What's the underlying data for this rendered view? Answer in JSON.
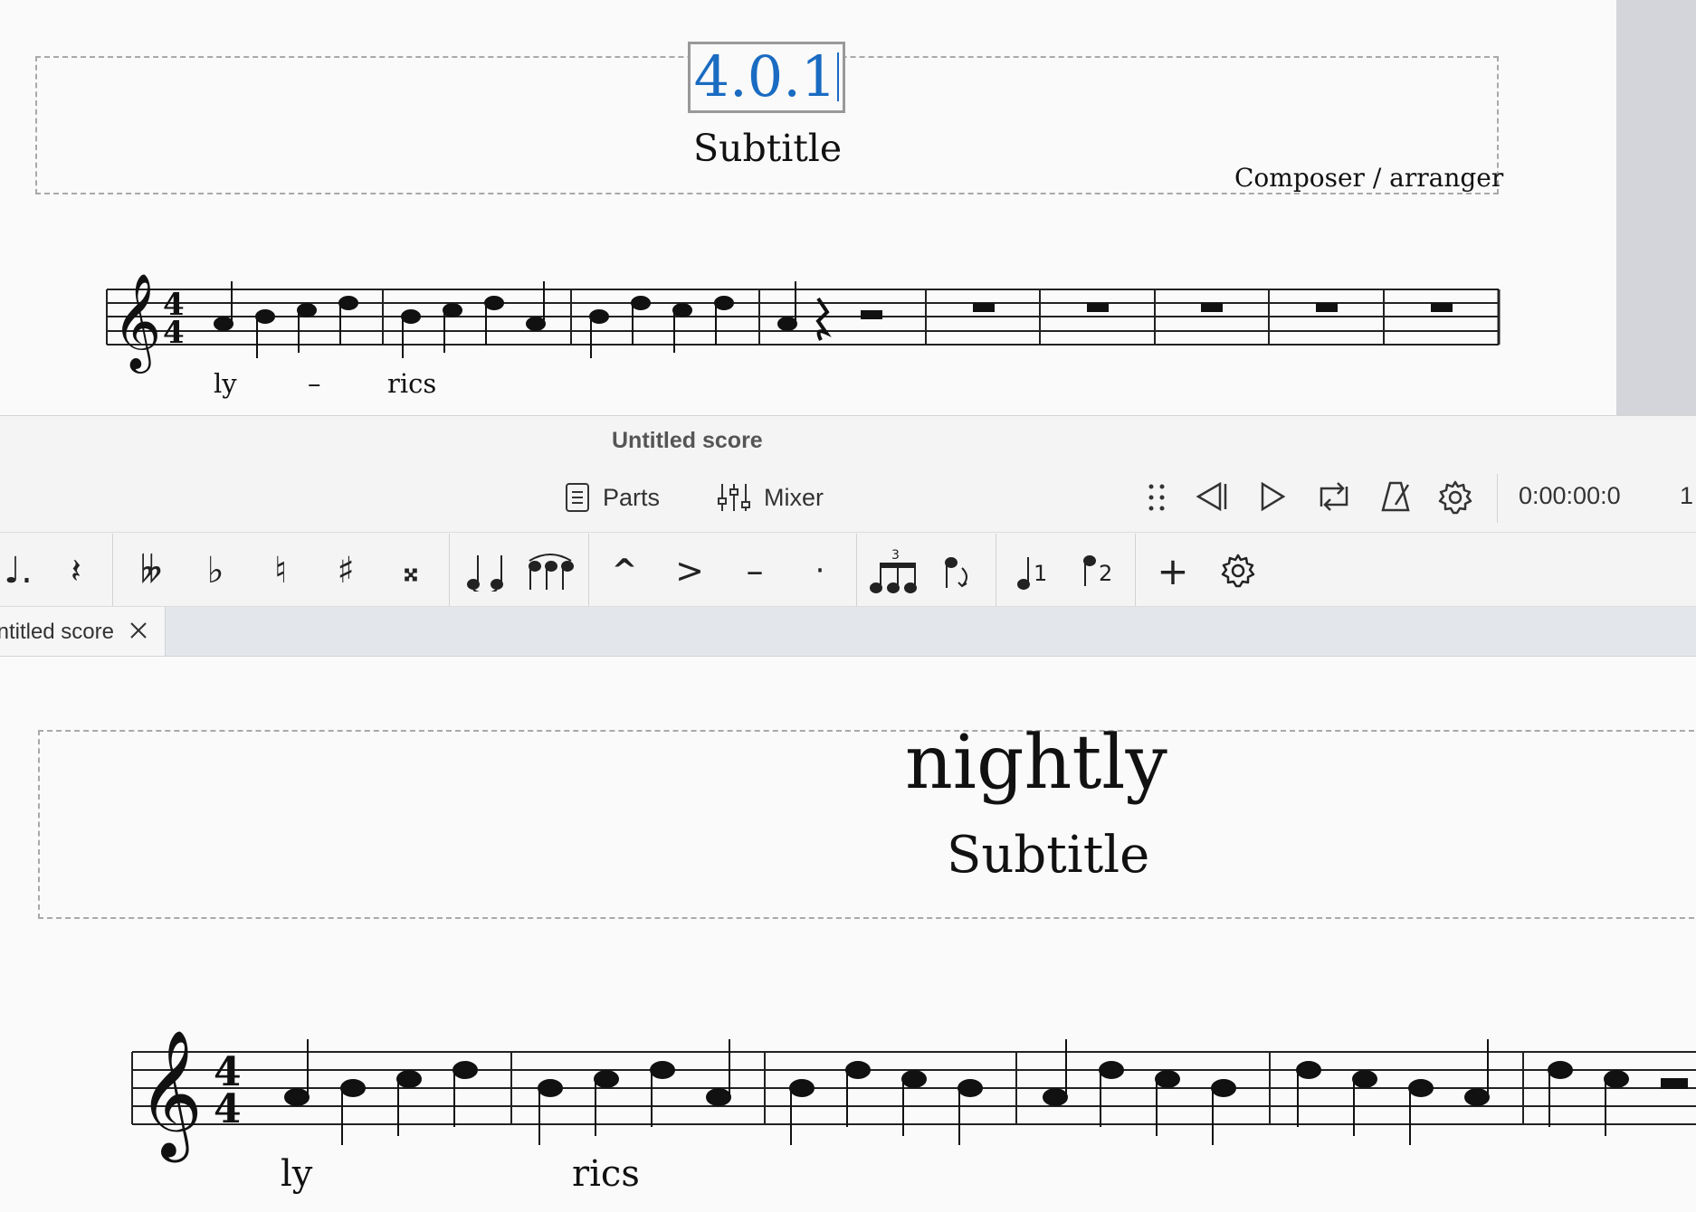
{
  "top_score": {
    "title": "4.0.1",
    "subtitle": "Subtitle",
    "composer": "Composer / arranger",
    "lyrics": [
      "ly",
      "–",
      "rics"
    ]
  },
  "window_title": "Untitled score",
  "toolbar": {
    "parts_label": "Parts",
    "mixer_label": "Mixer",
    "time_display": "0:00:00:0",
    "measure_display": "1"
  },
  "note_input": {
    "tuplet_number": "3",
    "voice_1": "1",
    "voice_2": "2"
  },
  "tab": {
    "label": "Untitled score"
  },
  "bottom_score": {
    "title": "nightly",
    "subtitle": "Subtitle",
    "lyrics": [
      "ly",
      "rics"
    ]
  }
}
